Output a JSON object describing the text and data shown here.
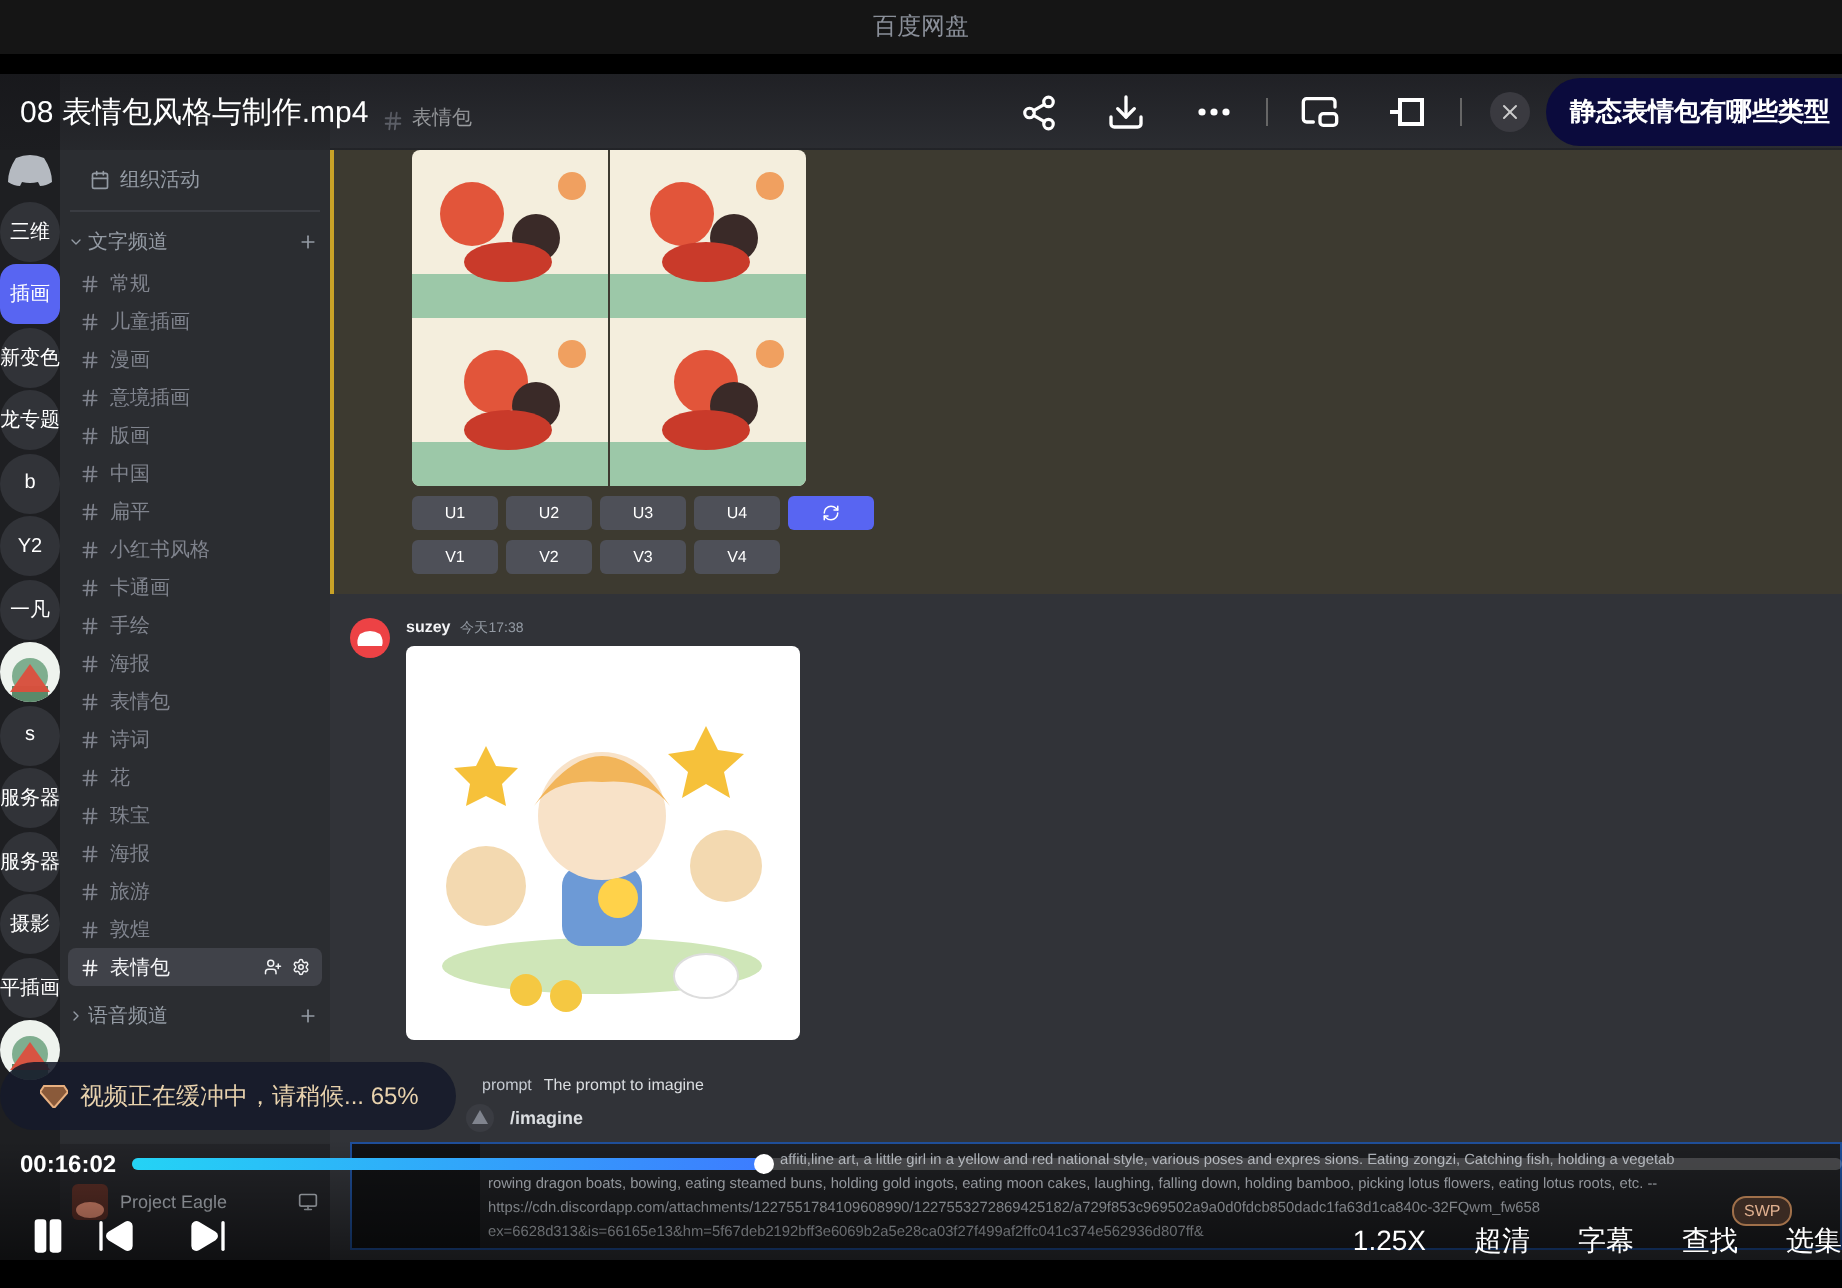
{
  "app_title": "百度网盘",
  "player": {
    "title": "08 表情包风格与制作.mp4",
    "question_pill": "静态表情包有哪些类型",
    "buffer_message": "视频正在缓冲中，请稍候... 65%",
    "time": "00:16:02",
    "progress": {
      "level": 0.37
    },
    "playing": true,
    "options": [
      "1.25X",
      "超清",
      "字幕",
      "查找",
      "选集"
    ],
    "badge": "SWP"
  },
  "servers": [
    {
      "label": "三维",
      "selected": false
    },
    {
      "label": "插画",
      "selected": true
    },
    {
      "label": "新变色",
      "selected": false
    },
    {
      "label": "龙专题",
      "selected": false
    },
    {
      "label": "b",
      "selected": false
    },
    {
      "label": "Y2",
      "selected": false
    },
    {
      "label": "一凡",
      "selected": false
    },
    {
      "kind": "picture",
      "selected": false
    },
    {
      "label": "s",
      "selected": false
    },
    {
      "label": "服务器",
      "selected": false
    },
    {
      "label": "服务器",
      "selected": false
    },
    {
      "label": "摄影",
      "selected": false
    },
    {
      "label": "平插画",
      "selected": false
    },
    {
      "kind": "picture",
      "selected": false
    }
  ],
  "events_label": "组织活动",
  "categories": [
    {
      "name": "文字频道",
      "expanded": true,
      "channels": [
        {
          "name": "常规",
          "selected": false
        },
        {
          "name": "儿童插画",
          "selected": false
        },
        {
          "name": "漫画",
          "selected": false
        },
        {
          "name": "意境插画",
          "selected": false
        },
        {
          "name": "版画",
          "selected": false
        },
        {
          "name": "中国",
          "selected": false
        },
        {
          "name": "扁平",
          "selected": false
        },
        {
          "name": "小红书风格",
          "selected": false
        },
        {
          "name": "卡通画",
          "selected": false
        },
        {
          "name": "手绘",
          "selected": false
        },
        {
          "name": "海报",
          "selected": false
        },
        {
          "name": "表情包",
          "selected": false
        },
        {
          "name": "诗词",
          "selected": false
        },
        {
          "name": "花",
          "selected": false
        },
        {
          "name": "珠宝",
          "selected": false
        },
        {
          "name": "海报",
          "selected": false
        },
        {
          "name": "旅游",
          "selected": false
        },
        {
          "name": "敦煌",
          "selected": false
        },
        {
          "name": "表情包",
          "selected": true
        }
      ]
    },
    {
      "name": "语音频道",
      "expanded": false
    }
  ],
  "user": {
    "name": "Project Eagle"
  },
  "channel_header": "表情包",
  "messages": [
    {
      "kind": "grid",
      "highlighted": true,
      "button_rows": [
        [
          {
            "kind": "text",
            "label": "U1"
          },
          {
            "kind": "text",
            "label": "U2"
          },
          {
            "kind": "text",
            "label": "U3"
          },
          {
            "kind": "text",
            "label": "U4"
          },
          {
            "kind": "refresh"
          }
        ],
        [
          {
            "kind": "text",
            "label": "V1"
          },
          {
            "kind": "text",
            "label": "V2"
          },
          {
            "kind": "text",
            "label": "V3"
          },
          {
            "kind": "text",
            "label": "V4"
          }
        ]
      ]
    },
    {
      "highlighted": false,
      "author": "suzey",
      "time": "今天17:38"
    }
  ],
  "command": {
    "option": "prompt",
    "hint": "The prompt to imagine",
    "name": "/imagine",
    "lines": [
      "affiti,line art, a little girl in a yellow and red national style, various poses and expres sions. Eating zongzi, Catching fish, holding a vegetab",
      "rowing dragon boats, bowing, eating steamed buns, holding gold ingots, eating moon cakes, laughing, falling down, holding bamboo, picking lotus flowers, eating lotus roots, etc. --",
      "https://cdn.discordapp.com/attachments/1227551784109608990/1227553272869425182/a729f853c969502a9a0d0fdcb850dadc1fa63d1ca840c-32FQwm_fw658",
      "ex=6628d313&is=66165e13&hm=5f67deb2192bff3e6069b2a5e28ca03f27f499af2ffc041c374e562936d807ff&"
    ]
  }
}
